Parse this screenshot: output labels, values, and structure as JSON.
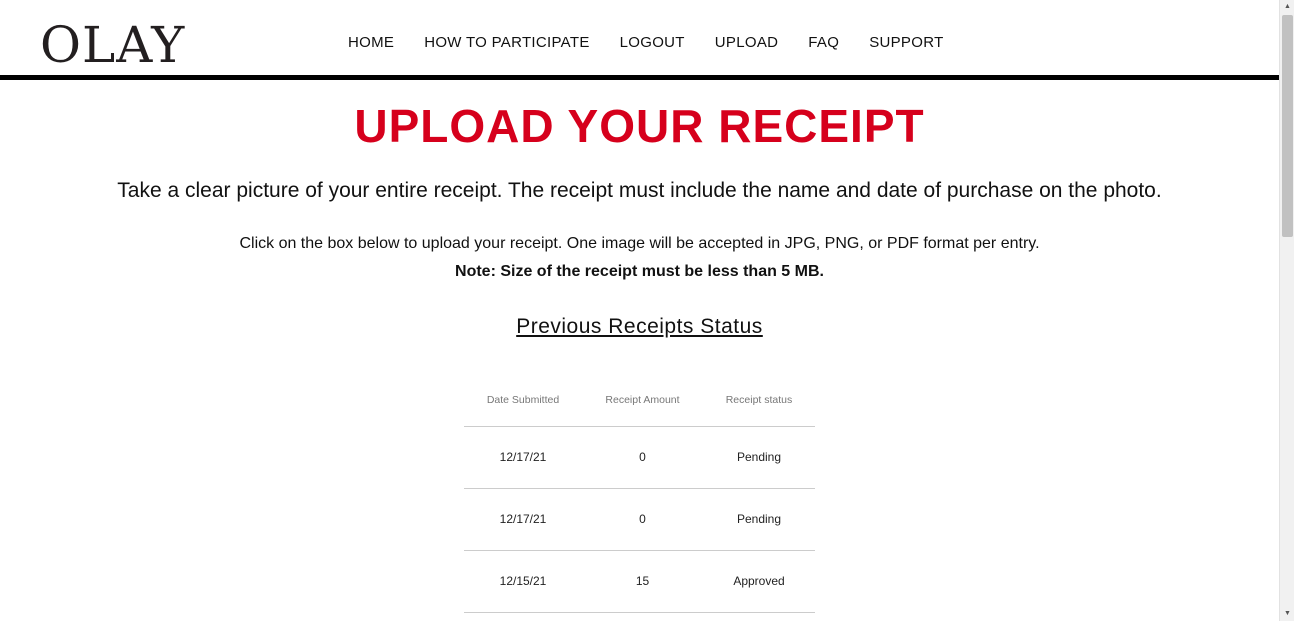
{
  "header": {
    "logo": "OLAY",
    "nav": [
      {
        "label": "HOME"
      },
      {
        "label": "HOW TO PARTICIPATE"
      },
      {
        "label": "LOGOUT"
      },
      {
        "label": "UPLOAD"
      },
      {
        "label": "FAQ"
      },
      {
        "label": "SUPPORT"
      }
    ]
  },
  "main": {
    "title": "UPLOAD YOUR RECEIPT",
    "lead": "Take a clear picture of your entire receipt. The receipt must include the name and date of purchase on the photo.",
    "instructions": "Click on the box below to upload your receipt. One image will be accepted in JPG, PNG, or PDF format per entry.",
    "note": "Note: Size of the receipt must be less than 5 MB.",
    "previous_title": "Previous Receipts Status"
  },
  "table": {
    "headers": [
      "Date Submitted",
      "Receipt Amount",
      "Receipt status"
    ],
    "rows": [
      [
        "12/17/21",
        "0",
        "Pending"
      ],
      [
        "12/17/21",
        "0",
        "Pending"
      ],
      [
        "12/15/21",
        "15",
        "Approved"
      ]
    ]
  },
  "colors": {
    "accent": "#d6001c",
    "text": "#111111",
    "header_rule": "#000000"
  },
  "icons": {
    "scroll_up": "scroll-up-arrow-icon",
    "scroll_down": "scroll-down-arrow-icon"
  }
}
